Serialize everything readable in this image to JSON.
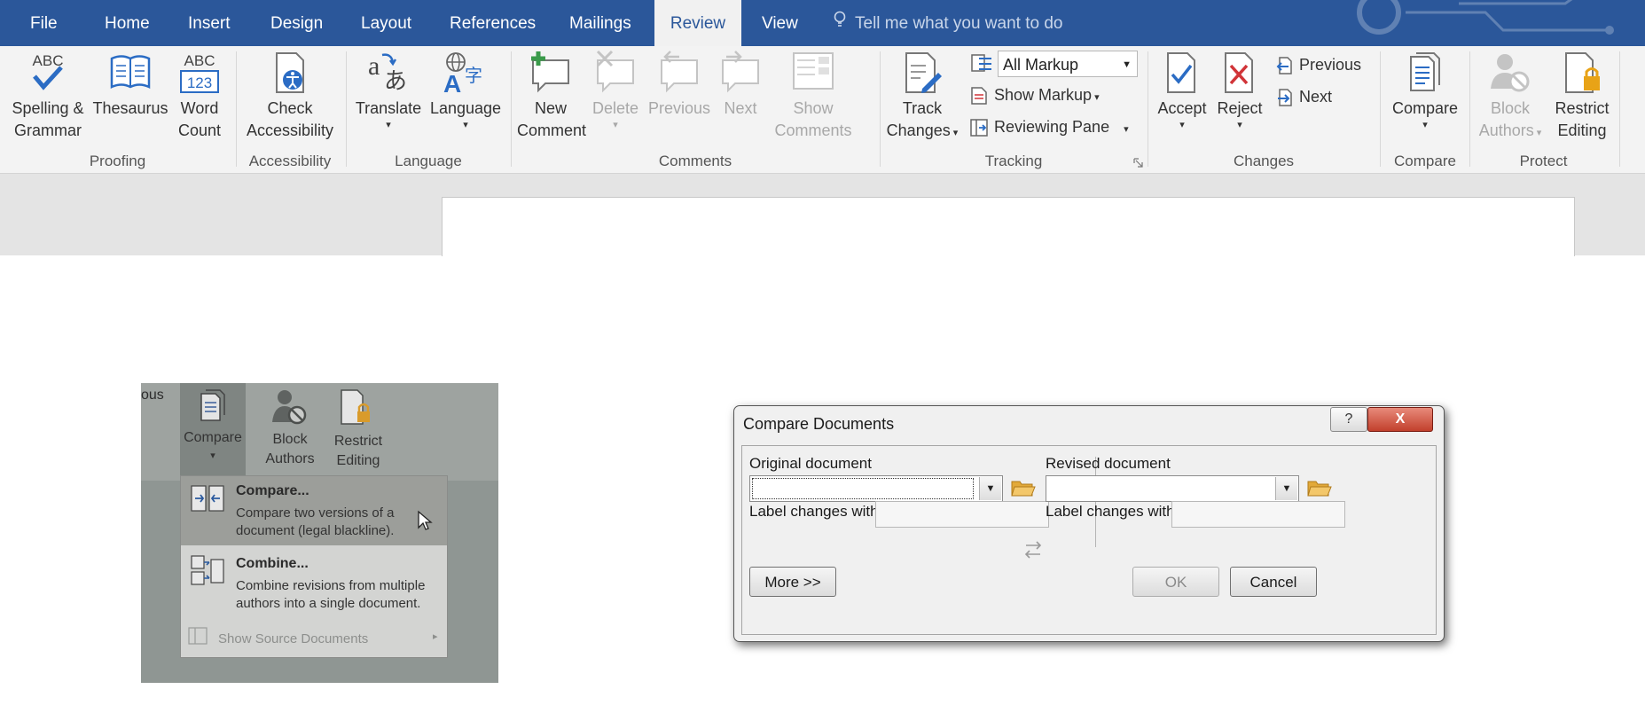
{
  "tabs": [
    "File",
    "Home",
    "Insert",
    "Design",
    "Layout",
    "References",
    "Mailings",
    "Review",
    "View"
  ],
  "active_tab": "Review",
  "tell_me": "Tell me what you want to do",
  "ribbon": {
    "proofing": {
      "spelling": [
        "Spelling &",
        "Grammar"
      ],
      "thesaurus": "Thesaurus",
      "word_count": [
        "Word",
        "Count"
      ],
      "icon_abc": "ABC",
      "icon_123": "123",
      "label": "Proofing"
    },
    "accessibility": {
      "check": [
        "Check",
        "Accessibility"
      ],
      "label": "Accessibility"
    },
    "language": {
      "translate": "Translate",
      "language": "Language",
      "label": "Language"
    },
    "comments": {
      "new": [
        "New",
        "Comment"
      ],
      "delete": "Delete",
      "previous": "Previous",
      "next": "Next",
      "show": [
        "Show",
        "Comments"
      ],
      "label": "Comments"
    },
    "tracking": {
      "track": [
        "Track",
        "Changes"
      ],
      "markup_select": "All Markup",
      "show_markup": "Show Markup",
      "reviewing_pane": "Reviewing Pane",
      "label": "Tracking"
    },
    "changes": {
      "accept": "Accept",
      "reject": "Reject",
      "previous": "Previous",
      "next": "Next",
      "label": "Changes"
    },
    "compare": {
      "compare": "Compare",
      "label": "Compare"
    },
    "protect": {
      "block": [
        "Block",
        "Authors"
      ],
      "restrict": [
        "Restrict",
        "Editing"
      ],
      "label": "Protect"
    }
  },
  "photo": {
    "ribbon_fragment": "ous",
    "compare_btn": "Compare",
    "block": [
      "Block",
      "Authors"
    ],
    "restrict": [
      "Restrict",
      "Editing"
    ],
    "menu": [
      {
        "title": "Compare...",
        "desc": [
          "Compare two versions of a",
          "document (legal blackline)."
        ]
      },
      {
        "title": "Combine...",
        "desc": [
          "Combine revisions from multiple",
          "authors into a single document."
        ]
      }
    ],
    "show_source": "Show Source Documents"
  },
  "dialog": {
    "title": "Compare Documents",
    "help": "?",
    "close": "X",
    "original_label": "Original document",
    "revised_label": "Revised document",
    "label_changes_left": "Label changes with",
    "label_changes_right": "Label changes with",
    "more": "More >>",
    "ok": "OK",
    "cancel": "Cancel"
  },
  "colors": {
    "title_bar": "#2b579a",
    "ribbon_bg": "#f3f3f3",
    "accent_red": "#d13438"
  }
}
